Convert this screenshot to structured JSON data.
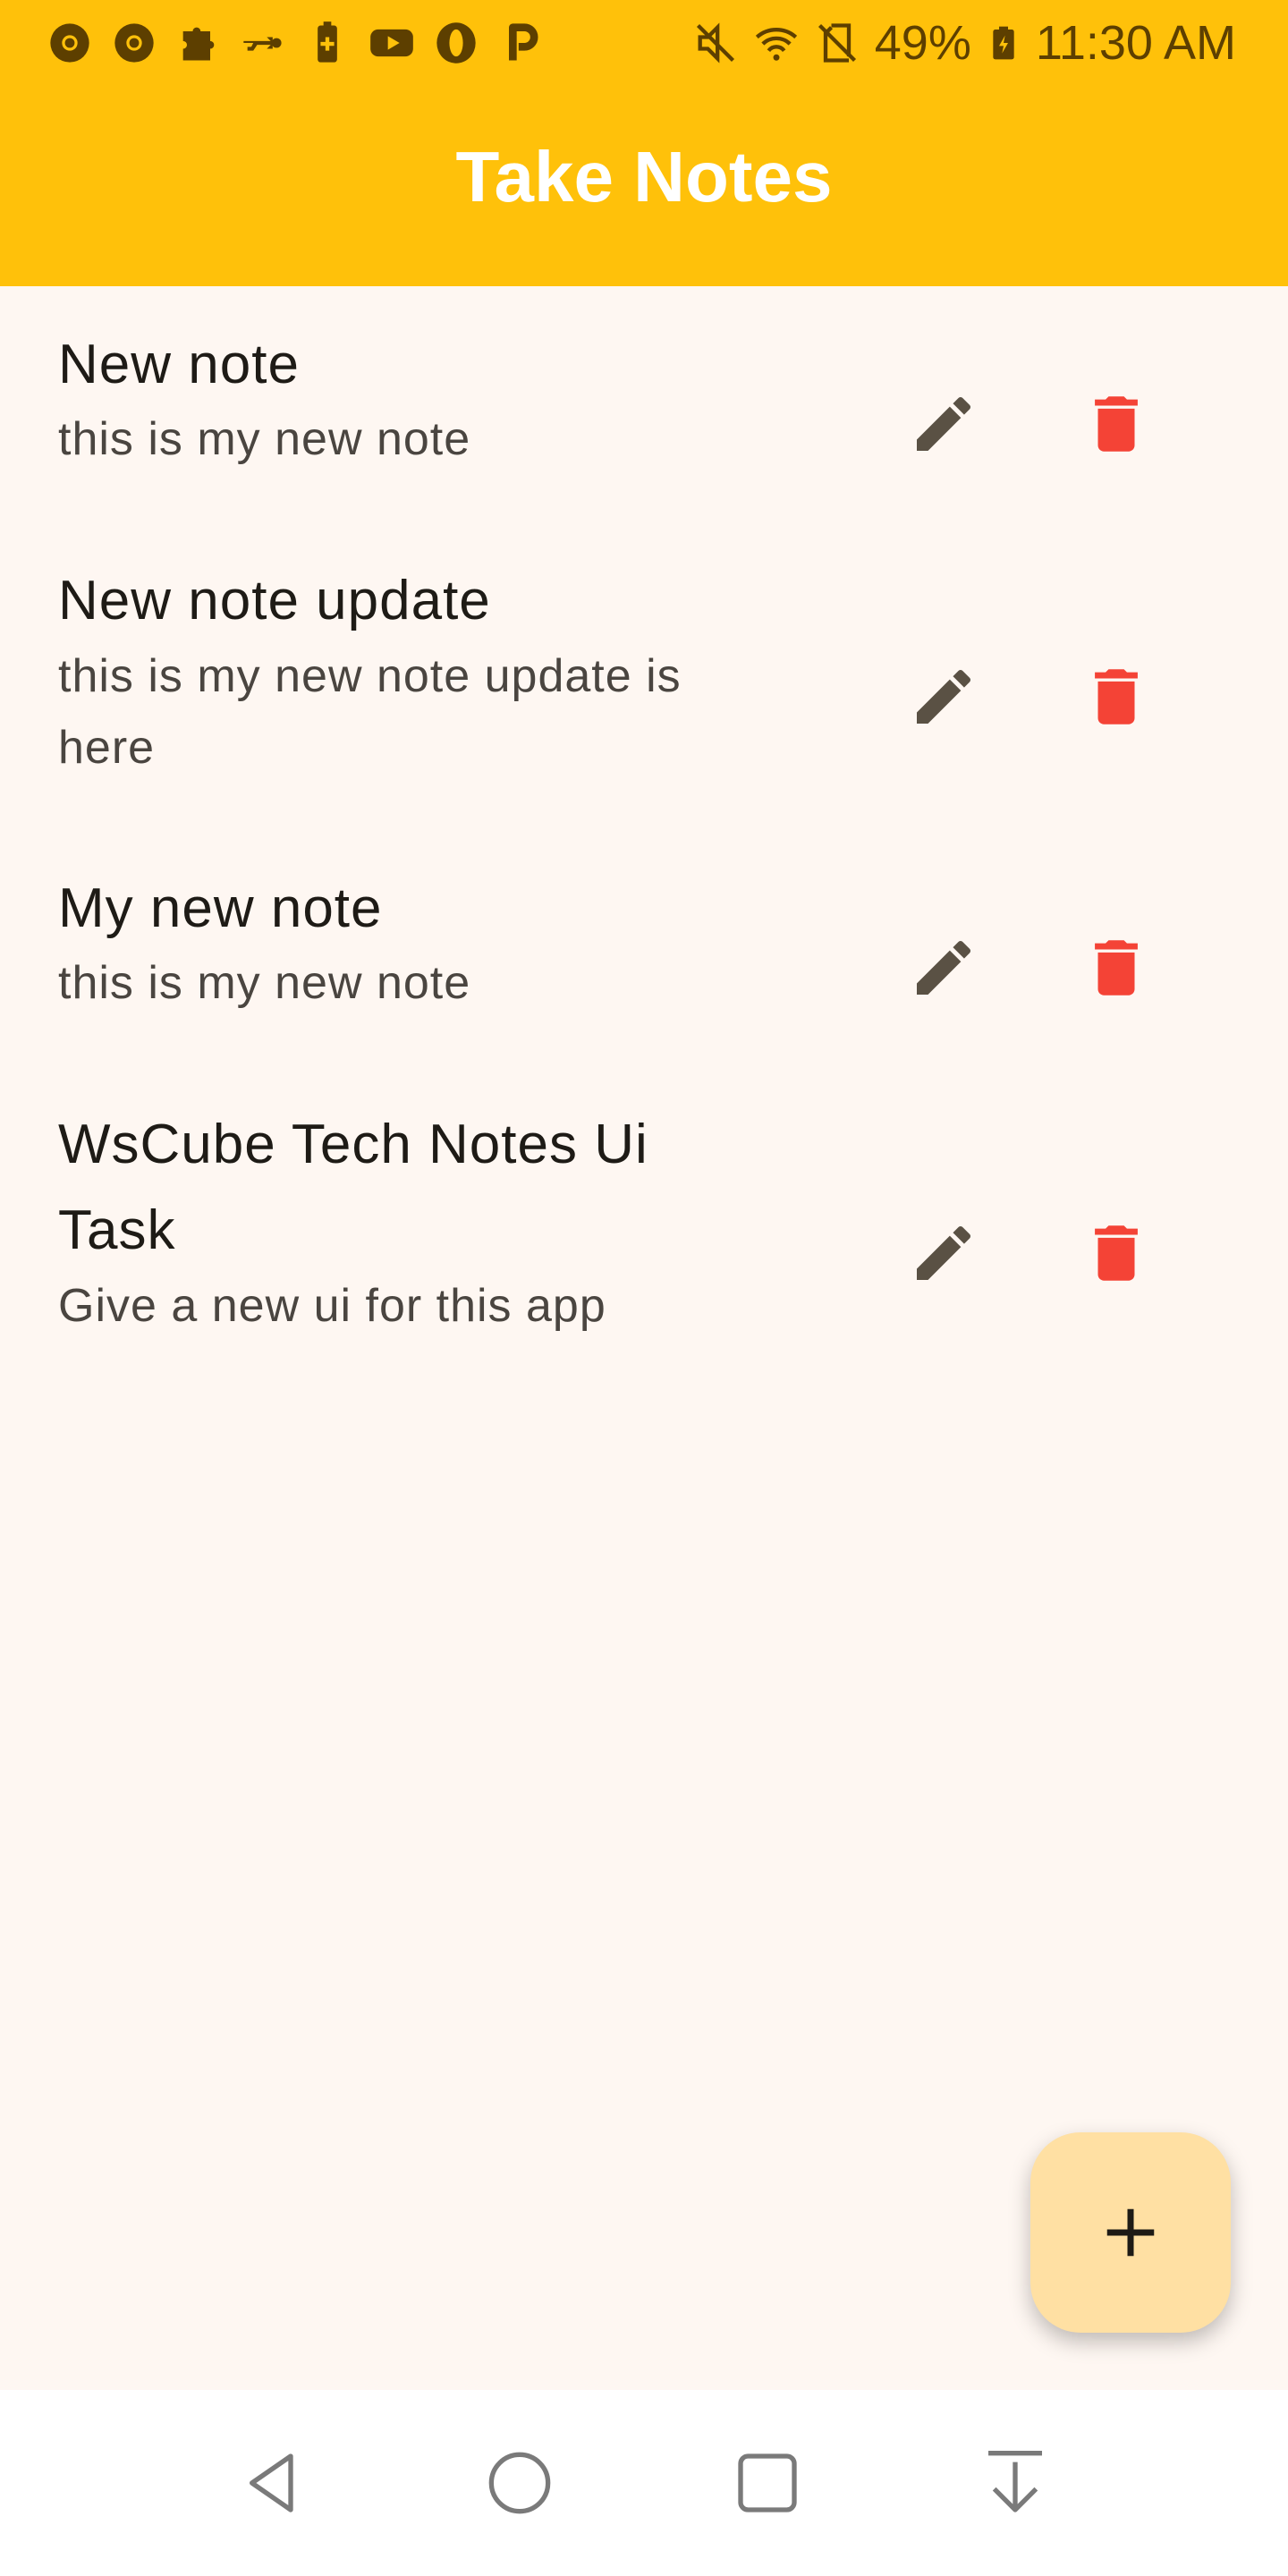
{
  "status_bar": {
    "battery": "49%",
    "time": "11:30 AM",
    "left_icons": [
      "chrome-icon",
      "chrome-icon",
      "puzzle-icon",
      "usb-icon",
      "battery-saver-icon",
      "youtube-icon",
      "opera-icon",
      "paytm-icon"
    ],
    "right_icons": [
      "mute-icon",
      "wifi-icon",
      "no-sim-icon",
      "battery-charging-icon"
    ]
  },
  "app_bar": {
    "title": "Take Notes"
  },
  "notes": [
    {
      "title": "New note",
      "description": "this is my new note"
    },
    {
      "title": "New note update",
      "description": "this is my new note update is here"
    },
    {
      "title": "My new note",
      "description": "this is my new note"
    },
    {
      "title": "WsCube Tech Notes Ui Task",
      "description": "Give a new ui for this app"
    }
  ],
  "icons": {
    "edit": "pencil-icon",
    "delete": "trash-icon",
    "add": "plus-icon"
  },
  "colors": {
    "app_bar": "#FFC10A",
    "background": "#FEF7F2",
    "edit_icon": "#5A5144",
    "delete_icon": "#F44336",
    "fab": "#FFE0A3"
  },
  "nav_bar": [
    "back-icon",
    "home-icon",
    "recents-icon",
    "notifications-pull-icon"
  ]
}
